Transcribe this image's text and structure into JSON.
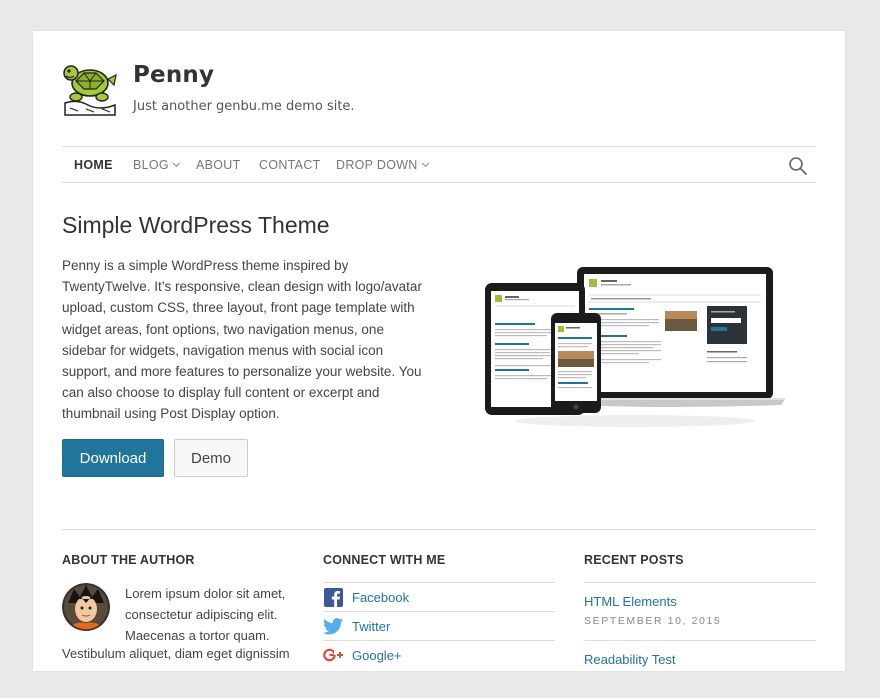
{
  "header": {
    "site_title": "Penny",
    "site_description": "Just another genbu.me demo site.",
    "logo_icon": "turtle-logo"
  },
  "nav": {
    "items": [
      {
        "label": "HOME",
        "active": true
      },
      {
        "label": "BLOG",
        "dropdown": true
      },
      {
        "label": "ABOUT"
      },
      {
        "label": "CONTACT"
      },
      {
        "label": "DROP DOWN",
        "dropdown": true
      }
    ],
    "search_icon": "search-icon"
  },
  "hero": {
    "title": "Simple WordPress Theme",
    "text": "Penny is a simple WordPress theme inspired by TwentyTwelve. It’s responsive, clean design with logo/avatar upload, custom CSS, three layout, front page template with widget areas, font options, two navigation menus, one sidebar for widgets,  navigation menus with social icon support, and more features to personalize your website. You can also choose to display full content or excerpt and thumbnail using Post Display option.",
    "download_label": "Download",
    "demo_label": "Demo"
  },
  "widgets": {
    "about": {
      "title": "ABOUT THE AUTHOR",
      "text": "Lorem ipsum dolor sit amet, consectetur adipiscing elit. Maecenas a tortor quam.",
      "text_more": "Vestibulum aliquet, diam eget dignissim"
    },
    "connect": {
      "title": "CONNECT WITH ME",
      "items": [
        {
          "label": "Facebook",
          "icon": "facebook-icon"
        },
        {
          "label": "Twitter",
          "icon": "twitter-icon"
        },
        {
          "label": "Google+",
          "icon": "google-plus-icon"
        }
      ]
    },
    "recent": {
      "title": "RECENT POSTS",
      "posts": [
        {
          "title": "HTML Elements",
          "date": "SEPTEMBER 10, 2015"
        },
        {
          "title": "Readability Test",
          "date": ""
        }
      ]
    }
  },
  "colors": {
    "accent": "#21759b",
    "background": "#e9e9e9"
  }
}
